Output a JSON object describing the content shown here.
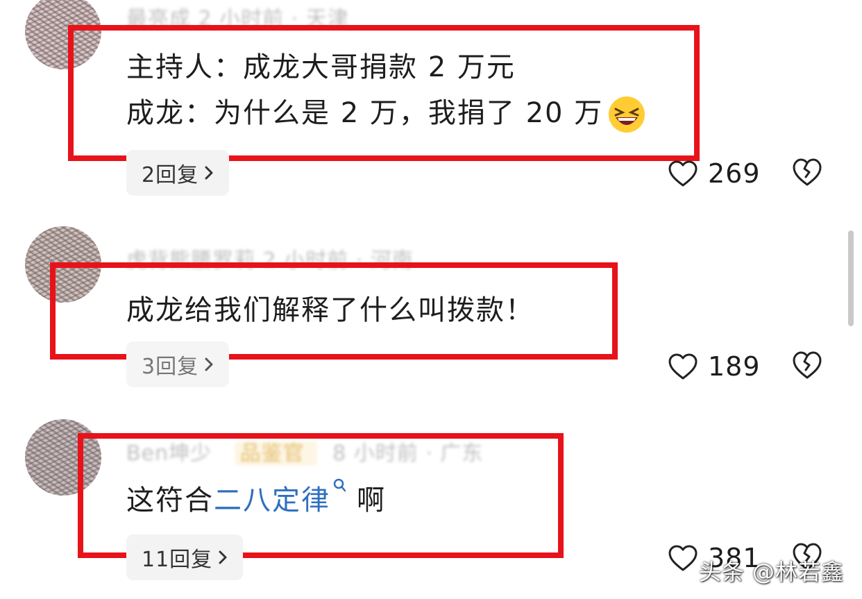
{
  "comments": [
    {
      "meta": "最亮成 2 小时前 · 天津",
      "lines": [
        "主持人：成龙大哥捐款 2 万元",
        "成龙：为什么是 2 万，我捐了 20 万"
      ],
      "emoji": "grinning-squinting-face",
      "replies": "2回复",
      "likes": "269"
    },
    {
      "meta": "虎背熊腰罗莉 2 小时前 · 河南",
      "lines": [
        "成龙给我们解释了什么叫拨款！"
      ],
      "replies": "3回复",
      "likes": "189"
    },
    {
      "meta_name": "Ben坤少",
      "meta_badge": "品鉴官",
      "meta_rest": "8 小时前 · 广东",
      "text_prefix": "这符合",
      "text_link": "二八定律",
      "text_suffix": "啊",
      "replies": "11回复",
      "likes": "381"
    }
  ],
  "watermark": "头条 @林若鑫",
  "colors": {
    "highlight_box": "#e8121a",
    "link": "#2f6fbf",
    "meta_text": "#a9a9a9"
  },
  "icons": [
    "heart-icon",
    "broken-heart-icon",
    "chevron-right-icon",
    "search-icon"
  ]
}
